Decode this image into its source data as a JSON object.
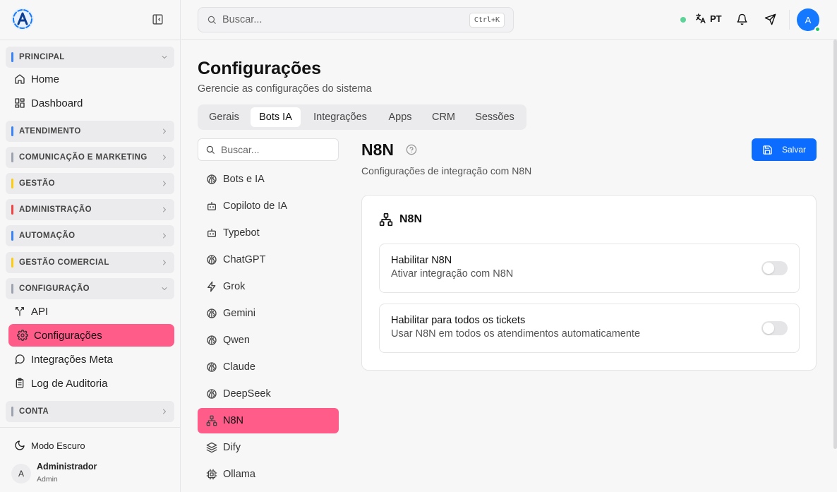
{
  "sidebar": {
    "sections": [
      {
        "label": "PRINCIPAL",
        "color": "#3b82f6",
        "expanded": true
      },
      {
        "label": "ATENDIMENTO",
        "color": "#3b82f6",
        "expanded": false
      },
      {
        "label": "COMUNICAÇÃO E MARKETING",
        "color": "#9ca3af",
        "expanded": false
      },
      {
        "label": "GESTÃO",
        "color": "#facc15",
        "expanded": false
      },
      {
        "label": "ADMINISTRAÇÃO",
        "color": "#ef4444",
        "expanded": false
      },
      {
        "label": "AUTOMAÇÃO",
        "color": "#3b82f6",
        "expanded": false
      },
      {
        "label": "GESTÃO COMERCIAL",
        "color": "#facc15",
        "expanded": false
      },
      {
        "label": "CONFIGURAÇÃO",
        "color": "#9ca3af",
        "expanded": true
      },
      {
        "label": "CONTA",
        "color": "#9ca3af",
        "expanded": false
      }
    ],
    "items": [
      {
        "label": "Home",
        "icon": "home-icon"
      },
      {
        "label": "Dashboard",
        "icon": "dashboard-icon"
      },
      {
        "label": "API",
        "icon": "api-icon"
      },
      {
        "label": "Configurações",
        "icon": "gear-icon",
        "active": true
      },
      {
        "label": "Integrações Meta",
        "icon": "chat-bubble-icon"
      },
      {
        "label": "Log de Auditoria",
        "icon": "clipboard-icon"
      }
    ],
    "dark_mode_label": "Modo Escuro",
    "user": {
      "initial": "A",
      "name": "Administrador",
      "role": "Admin"
    }
  },
  "topbar": {
    "search_placeholder": "Buscar...",
    "shortcut": "Ctrl+K",
    "language": "PT",
    "avatar_initial": "A"
  },
  "page": {
    "title": "Configurações",
    "subtitle": "Gerencie as configurações do sistema",
    "tabs": [
      "Gerais",
      "Bots IA",
      "Integrações",
      "Apps",
      "CRM",
      "Sessões"
    ],
    "active_tab": "Bots IA"
  },
  "submenu": {
    "search_placeholder": "Buscar...",
    "items": [
      {
        "label": "Bots e IA",
        "icon": "brain-icon"
      },
      {
        "label": "Copiloto de IA",
        "icon": "bot-icon"
      },
      {
        "label": "Typebot",
        "icon": "bot-icon"
      },
      {
        "label": "ChatGPT",
        "icon": "brain-icon"
      },
      {
        "label": "Grok",
        "icon": "zap-icon"
      },
      {
        "label": "Gemini",
        "icon": "brain-icon"
      },
      {
        "label": "Qwen",
        "icon": "brain-icon"
      },
      {
        "label": "Claude",
        "icon": "brain-icon"
      },
      {
        "label": "DeepSeek",
        "icon": "brain-icon"
      },
      {
        "label": "N8N",
        "icon": "network-icon",
        "active": true
      },
      {
        "label": "Dify",
        "icon": "layers-icon"
      },
      {
        "label": "Ollama",
        "icon": "cpu-icon"
      }
    ]
  },
  "detail": {
    "title": "N8N",
    "subtitle": "Configurações de integração com N8N",
    "save_label": "Salvar",
    "card_title": "N8N",
    "settings": [
      {
        "title": "Habilitar N8N",
        "description": "Ativar integração com N8N",
        "enabled": false
      },
      {
        "title": "Habilitar para todos os tickets",
        "description": "Usar N8N em todos os atendimentos automaticamente",
        "enabled": false
      }
    ]
  },
  "colors": {
    "accent_pink": "#ff5c8a",
    "primary_blue": "#0b6cff",
    "online_green": "#23c55e"
  }
}
